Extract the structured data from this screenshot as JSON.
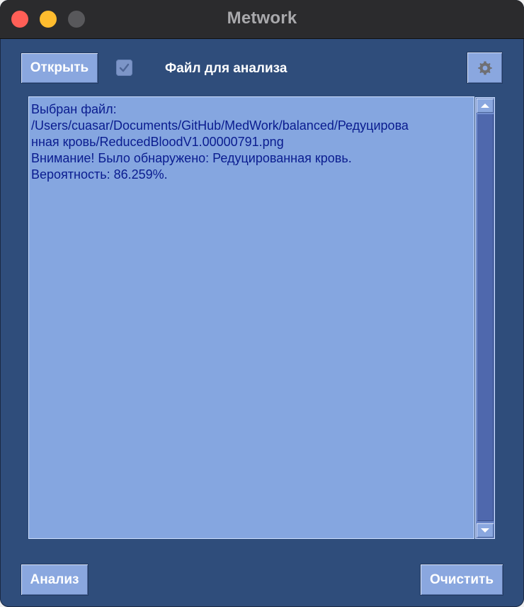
{
  "window": {
    "title": "Metwork"
  },
  "toolbar": {
    "open_label": "Открыть",
    "checkbox_checked": true,
    "file_label": "Файл для анализа",
    "settings_icon": "gear-icon"
  },
  "output": {
    "text": "Выбран файл:\n/Users/cuasar/Documents/GitHub/MedWork/balanced/Редуцирова\nнная кровь/ReducedBloodV1.00000791.png\nВнимание! Было обнаружено: Редуцированная кровь.\nВероятность: 86.259%."
  },
  "footer": {
    "analyze_label": "Анализ",
    "clear_label": "Очистить"
  },
  "colors": {
    "window_bg": "#2f4d7b",
    "button_bg": "#8aa7df",
    "text_area_bg": "#85a6e0",
    "text_color": "#0a1c8f"
  }
}
